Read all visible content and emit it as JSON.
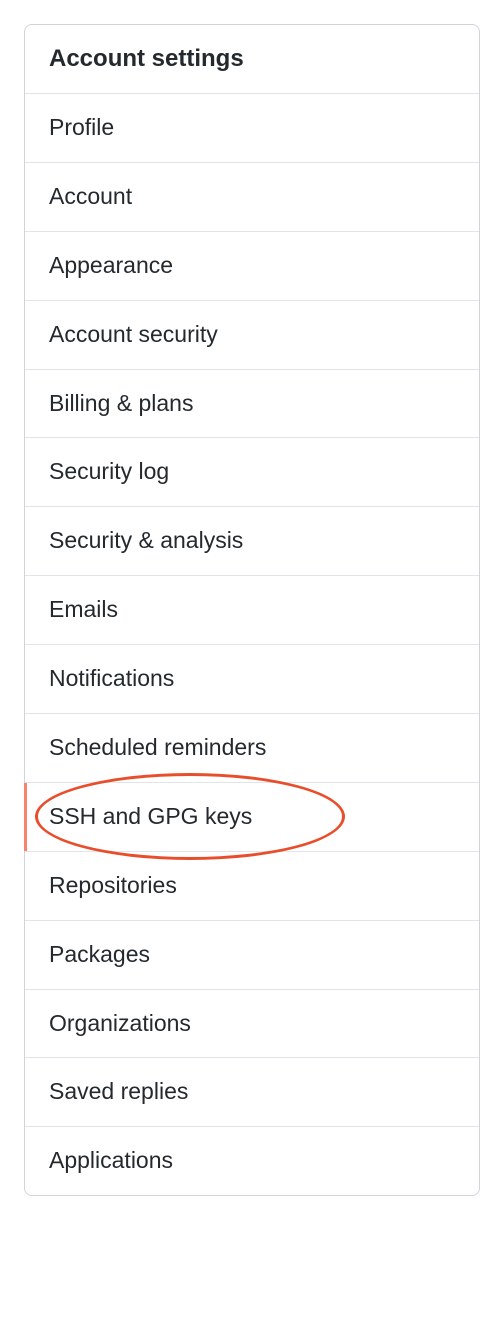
{
  "menu": {
    "header": "Account settings",
    "items": [
      {
        "label": "Profile",
        "selected": false
      },
      {
        "label": "Account",
        "selected": false
      },
      {
        "label": "Appearance",
        "selected": false
      },
      {
        "label": "Account security",
        "selected": false
      },
      {
        "label": "Billing & plans",
        "selected": false
      },
      {
        "label": "Security log",
        "selected": false
      },
      {
        "label": "Security & analysis",
        "selected": false
      },
      {
        "label": "Emails",
        "selected": false
      },
      {
        "label": "Notifications",
        "selected": false
      },
      {
        "label": "Scheduled reminders",
        "selected": false
      },
      {
        "label": "SSH and GPG keys",
        "selected": true,
        "highlighted": true
      },
      {
        "label": "Repositories",
        "selected": false
      },
      {
        "label": "Packages",
        "selected": false
      },
      {
        "label": "Organizations",
        "selected": false
      },
      {
        "label": "Saved replies",
        "selected": false
      },
      {
        "label": "Applications",
        "selected": false
      }
    ]
  }
}
